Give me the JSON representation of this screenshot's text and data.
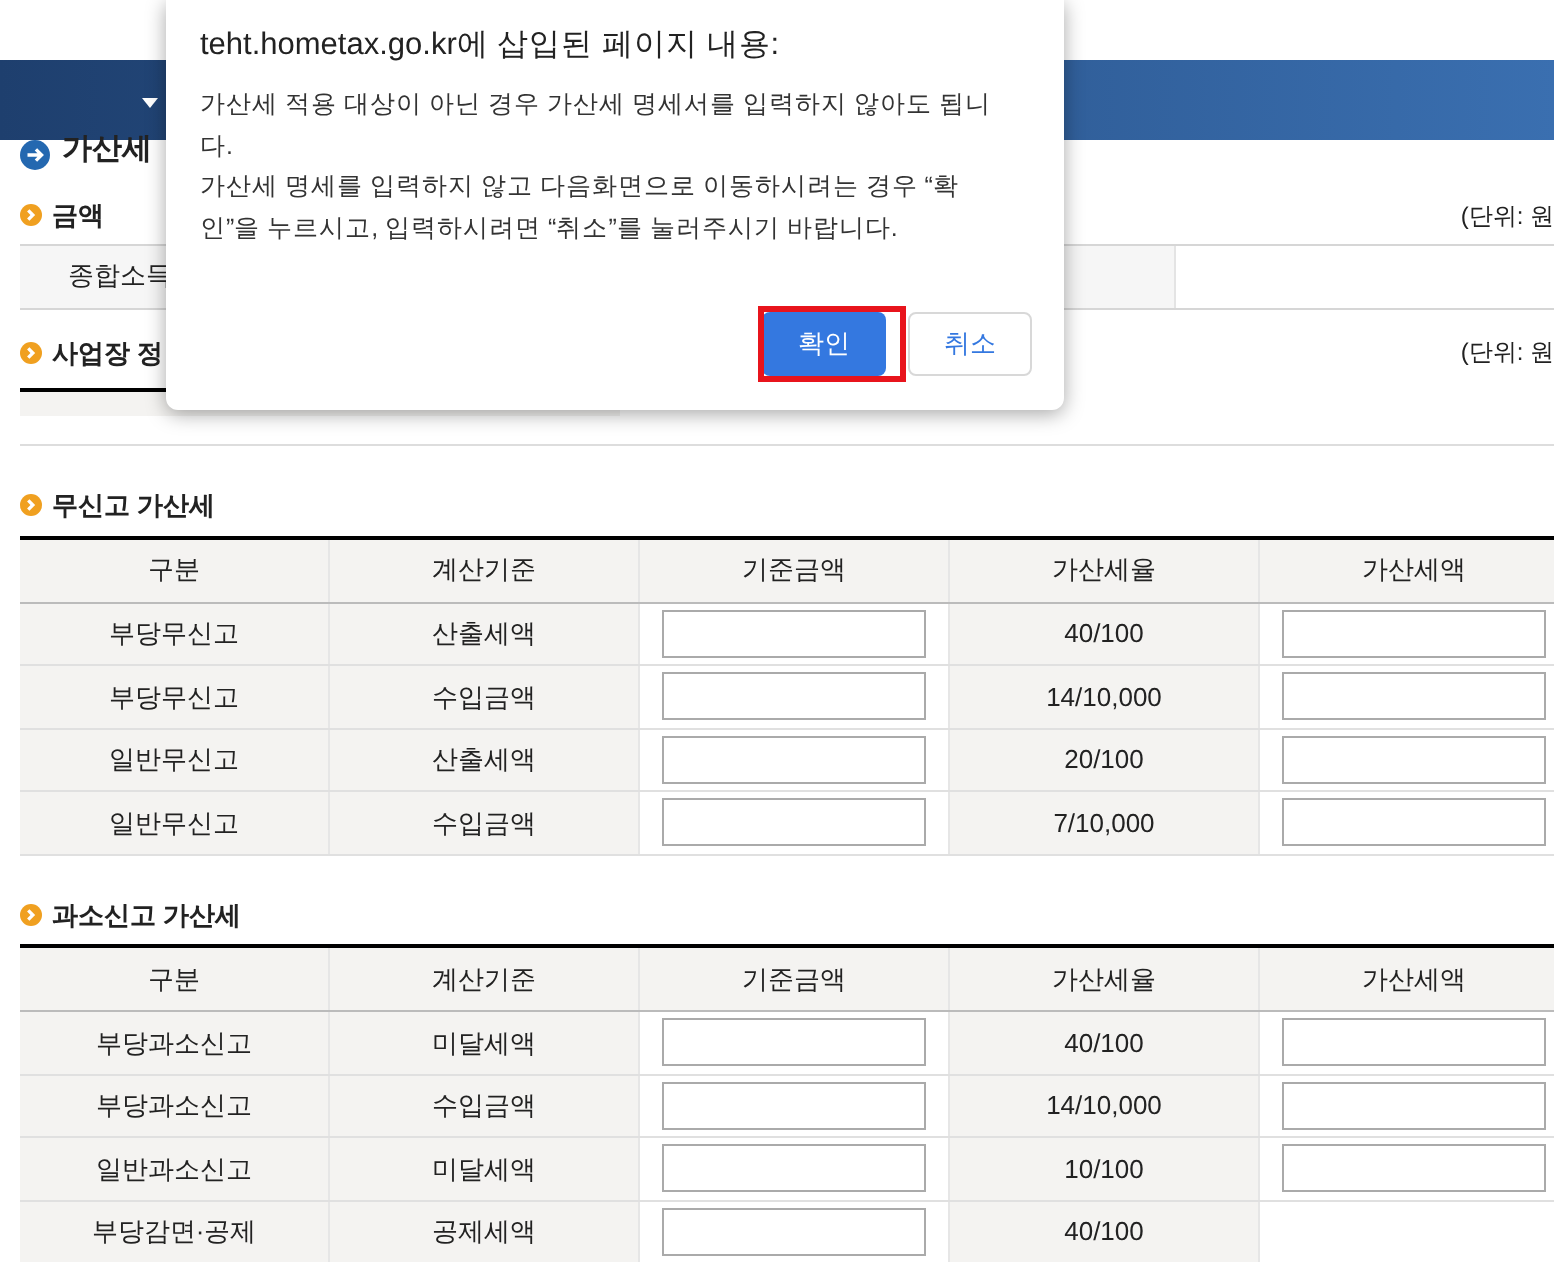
{
  "nav_bar": {
    "has_dropdown": true
  },
  "page_title": "가산세",
  "amount_section": {
    "title": "금액",
    "unit": "(단위: 원",
    "row_label": "종합소득"
  },
  "business_section": {
    "title": "사업장 정",
    "unit": "(단위: 원"
  },
  "tables": [
    {
      "title": "무신고 가산세",
      "columns": [
        "구분",
        "계산기준",
        "기준금액",
        "가산세율",
        "가산세액"
      ],
      "rows": [
        [
          {
            "kind": "text",
            "text": "부당무신고"
          },
          {
            "kind": "text",
            "text": "산출세액"
          },
          {
            "kind": "input"
          },
          {
            "kind": "text",
            "text": "40/100"
          },
          {
            "kind": "input"
          }
        ],
        [
          {
            "kind": "text",
            "text": "부당무신고"
          },
          {
            "kind": "text",
            "text": "수입금액"
          },
          {
            "kind": "input"
          },
          {
            "kind": "text",
            "text": "14/10,000"
          },
          {
            "kind": "input"
          }
        ],
        [
          {
            "kind": "text",
            "text": "일반무신고"
          },
          {
            "kind": "text",
            "text": "산출세액"
          },
          {
            "kind": "input"
          },
          {
            "kind": "text",
            "text": "20/100"
          },
          {
            "kind": "input"
          }
        ],
        [
          {
            "kind": "text",
            "text": "일반무신고"
          },
          {
            "kind": "text",
            "text": "수입금액"
          },
          {
            "kind": "input"
          },
          {
            "kind": "text",
            "text": "7/10,000"
          },
          {
            "kind": "input"
          }
        ]
      ]
    },
    {
      "title": "과소신고 가산세",
      "columns": [
        "구분",
        "계산기준",
        "기준금액",
        "가산세율",
        "가산세액"
      ],
      "rows": [
        [
          {
            "kind": "text",
            "text": "부당과소신고"
          },
          {
            "kind": "text",
            "text": "미달세액"
          },
          {
            "kind": "input"
          },
          {
            "kind": "text",
            "text": "40/100"
          },
          {
            "kind": "input"
          }
        ],
        [
          {
            "kind": "text",
            "text": "부당과소신고"
          },
          {
            "kind": "text",
            "text": "수입금액"
          },
          {
            "kind": "input"
          },
          {
            "kind": "text",
            "text": "14/10,000"
          },
          {
            "kind": "input"
          }
        ],
        [
          {
            "kind": "text",
            "text": "일반과소신고"
          },
          {
            "kind": "text",
            "text": "미달세액"
          },
          {
            "kind": "input"
          },
          {
            "kind": "text",
            "text": "10/100"
          },
          {
            "kind": "input"
          }
        ],
        [
          {
            "kind": "text",
            "text": "부당감면·공제"
          },
          {
            "kind": "text",
            "text": "공제세액"
          },
          {
            "kind": "input"
          },
          {
            "kind": "text",
            "text": "40/100"
          },
          {
            "kind": "blank"
          }
        ]
      ]
    }
  ],
  "dialog": {
    "title": "teht.hometax.go.kr에 삽입된 페이지 내용:",
    "message_lines": [
      "가산세 적용 대상이 아닌 경우 가산세 명세서를 입력하지 않아도 됩니",
      "다.",
      "가산세 명세를 입력하지 않고 다음화면으로 이동하시려는 경우 “확",
      "인”을 누르시고, 입력하시려면 “취소”를 눌러주시기 바랍니다."
    ],
    "buttons": [
      {
        "label": "확인",
        "kind": "primary",
        "highlighted": true
      },
      {
        "label": "취소",
        "kind": "secondary",
        "highlighted": false
      }
    ]
  }
}
